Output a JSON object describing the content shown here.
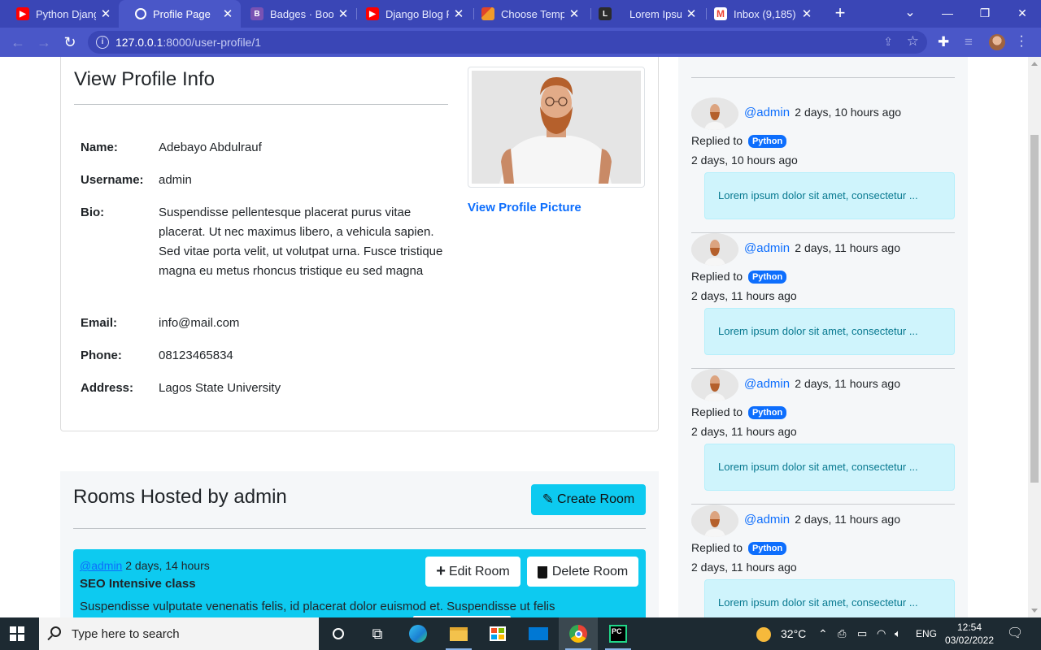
{
  "browser": {
    "tabs": [
      {
        "title": "Python Django",
        "favicon": "youtube-icon",
        "color": "#ff0000"
      },
      {
        "title": "Profile Page",
        "favicon": "globe-icon",
        "color": "#ffffff"
      },
      {
        "title": "Badges · Boots",
        "favicon": "bootstrap-icon",
        "color": "#7952b3"
      },
      {
        "title": "Django Blog Pr",
        "favicon": "youtube-icon",
        "color": "#ff0000"
      },
      {
        "title": "Choose Templa",
        "favicon": "template-icon",
        "color": "#e0442a"
      },
      {
        "title": "Lorem Ipsum -",
        "favicon": "lorem-icon",
        "color": "#2b2b2b"
      },
      {
        "title": "Inbox (9,185) -",
        "favicon": "gmail-icon",
        "color": "#ea4335"
      }
    ],
    "url_host": "127.0.0.1",
    "url_path": ":8000/user-profile/1"
  },
  "profile": {
    "heading": "View Profile Info",
    "view_picture_link": "View Profile Picture",
    "fields": {
      "name": {
        "label": "Name:",
        "value": "Adebayo Abdulrauf"
      },
      "username": {
        "label": "Username:",
        "value": "admin"
      },
      "bio": {
        "label": "Bio:",
        "value": "Suspendisse pellentesque placerat purus vitae placerat. Ut nec maximus libero, a vehicula sapien. Sed vitae porta velit, ut volutpat urna. Fusce tristique magna eu metus rhoncus tristique eu sed magna"
      },
      "email": {
        "label": "Email:",
        "value": "info@mail.com"
      },
      "phone": {
        "label": "Phone:",
        "value": "08123465834"
      },
      "address": {
        "label": "Address:",
        "value": "Lagos State University"
      }
    }
  },
  "rooms": {
    "heading": "Rooms Hosted by admin",
    "create_label": "Create Room",
    "items": [
      {
        "host": "@admin",
        "age": "2 days, 14 hours",
        "title": "SEO Intensive class",
        "description": "Suspendisse vulputate venenatis felis, id placerat dolor euismod et. Suspendisse ut felis",
        "edit_label": "Edit Room",
        "delete_label": "Delete Room"
      }
    ]
  },
  "activity": {
    "items": [
      {
        "user": "@admin",
        "ago": "2 days, 10 hours ago",
        "replied_label": "Replied to",
        "topic": "Python",
        "time": "2 days, 10 hours ago",
        "message": "Lorem ipsum dolor sit amet, consectetur ..."
      },
      {
        "user": "@admin",
        "ago": "2 days, 11 hours ago",
        "replied_label": "Replied to",
        "topic": "Python",
        "time": "2 days, 11 hours ago",
        "message": "Lorem ipsum dolor sit amet, consectetur ..."
      },
      {
        "user": "@admin",
        "ago": "2 days, 11 hours ago",
        "replied_label": "Replied to",
        "topic": "Python",
        "time": "2 days, 11 hours ago",
        "message": "Lorem ipsum dolor sit amet, consectetur ..."
      },
      {
        "user": "@admin",
        "ago": "2 days, 11 hours ago",
        "replied_label": "Replied to",
        "topic": "Python",
        "time": "2 days, 11 hours ago",
        "message": "Lorem ipsum dolor sit amet, consectetur ..."
      }
    ]
  },
  "taskbar": {
    "search_placeholder": "Type here to search",
    "temperature": "32°C",
    "language": "ENG",
    "time": "12:54",
    "date": "03/02/2022"
  }
}
